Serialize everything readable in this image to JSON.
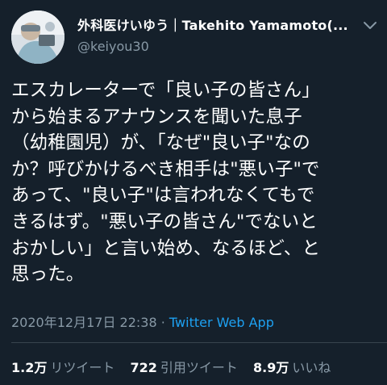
{
  "author": {
    "display_name": "外科医けいゆう｜Takehito Yamamoto(...",
    "handle": "@keiyou30"
  },
  "tweet": {
    "text": "エスカレーターで「良い子の皆さん」\nから始まるアナウンスを聞いた息子\n（幼稚園児）が、「なぜ\"良い子\"なの\nか？呼びかけるべき相手は\"悪い子\"で\nあって、\"良い子\"は言われなくてもで\nきるはず。\"悪い子の皆さん\"でないと\nおかしい」と言い始め、なるほど、と\n思った。",
    "timestamp": "2020年12月17日 22:38",
    "separator": " · ",
    "source": "Twitter Web App"
  },
  "stats": {
    "retweets_count": "1.2万",
    "retweets_label": "リツイート",
    "quotes_count": "722",
    "quotes_label": "引用ツイート",
    "likes_count": "8.9万",
    "likes_label": "いいね"
  },
  "icons": {
    "avatar": "avatar-photo",
    "menu": "chevron-down-icon"
  },
  "colors": {
    "background": "#15202b",
    "text_primary": "#ffffff",
    "text_secondary": "#8899a6",
    "link": "#1da1f2",
    "divider": "#38444d"
  }
}
